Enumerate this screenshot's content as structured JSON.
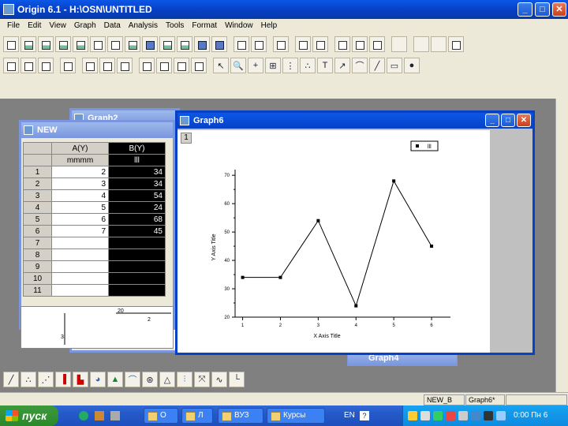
{
  "app": {
    "title": "Origin 6.1 - H:\\OSN\\UNTITLED",
    "caption_buttons": {
      "minimize": "_",
      "maximize": "□",
      "close": "✕"
    }
  },
  "menu": [
    "File",
    "Edit",
    "View",
    "Graph",
    "Data",
    "Analysis",
    "Tools",
    "Format",
    "Window",
    "Help"
  ],
  "windows": {
    "graph2": {
      "title": "Graph2"
    },
    "worksheet": {
      "title": "NEW",
      "columns": [
        {
          "name": "A(Y)",
          "label": "mmmm"
        },
        {
          "name": "B(Y)",
          "label": "lll"
        }
      ],
      "rows": [
        {
          "n": "1",
          "a": "2",
          "b": "34"
        },
        {
          "n": "2",
          "a": "3",
          "b": "34"
        },
        {
          "n": "3",
          "a": "4",
          "b": "54"
        },
        {
          "n": "4",
          "a": "5",
          "b": "24"
        },
        {
          "n": "5",
          "a": "6",
          "b": "68"
        },
        {
          "n": "6",
          "a": "7",
          "b": "45"
        },
        {
          "n": "7",
          "a": "",
          "b": ""
        },
        {
          "n": "8",
          "a": "",
          "b": ""
        },
        {
          "n": "9",
          "a": "",
          "b": ""
        },
        {
          "n": "10",
          "a": "",
          "b": ""
        },
        {
          "n": "11",
          "a": "",
          "b": ""
        }
      ]
    },
    "graph6": {
      "title": "Graph6",
      "layer": "1"
    },
    "graph4": {
      "title": "Graph4"
    }
  },
  "chart_data": {
    "type": "line",
    "x": [
      1,
      2,
      3,
      4,
      5,
      6
    ],
    "series": [
      {
        "name": "lll",
        "values": [
          34,
          34,
          54,
          24,
          68,
          45
        ]
      }
    ],
    "xlabel": "X Axis Title",
    "ylabel": "Y Axis Title",
    "xlim": [
      0.8,
      6.5
    ],
    "ylim": [
      20,
      72
    ],
    "xticks": [
      "1",
      "2",
      "3",
      "4",
      "5",
      "6"
    ],
    "yticks": [
      "20",
      "30",
      "40",
      "50",
      "60",
      "70"
    ],
    "legend": "top-right"
  },
  "background_graph": {
    "tick1": "20",
    "tick2": "2",
    "tick3": "3"
  },
  "status": {
    "cell1": "NEW_B",
    "cell2": "Graph6*"
  },
  "taskbar": {
    "start": "пуск",
    "buttons": [
      "О",
      "Л",
      "ВУЗ",
      "Курсы"
    ],
    "lang": "EN",
    "clock": "0:00 Пн 6"
  },
  "colors": {
    "accent": "#0840c8",
    "taskbar": "#245ac8",
    "start": "#2b882b"
  }
}
